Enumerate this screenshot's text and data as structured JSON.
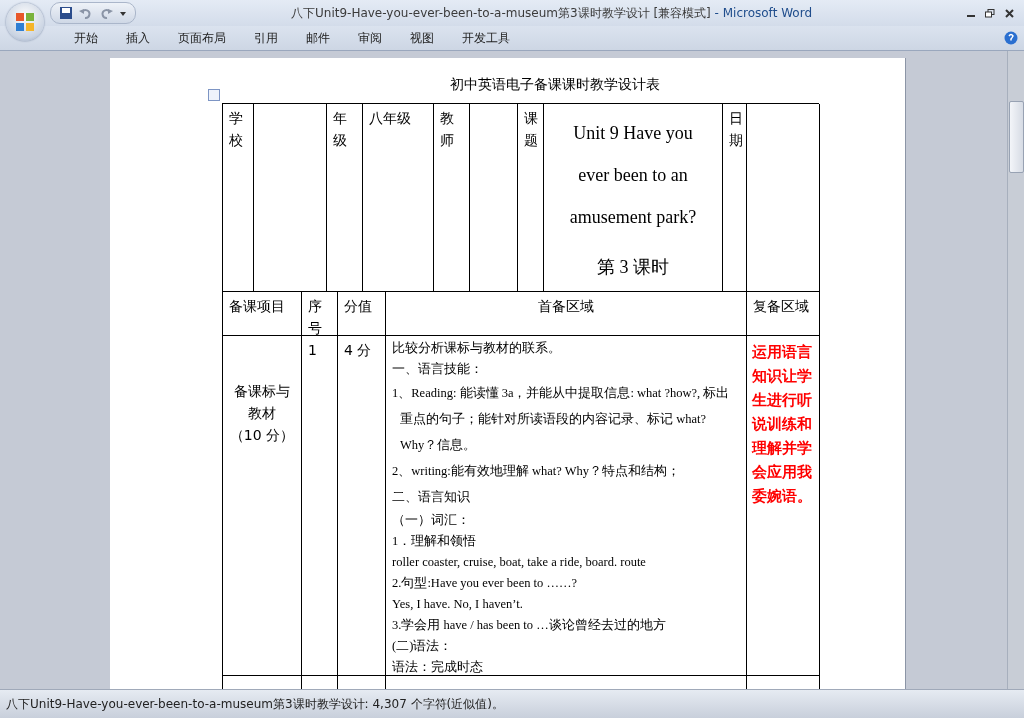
{
  "window": {
    "title": "八下Unit9-Have-you-ever-been-to-a-museum第3课时教学设计 [兼容模式]",
    "app": " - Microsoft Word"
  },
  "ribbon_tabs": [
    "开始",
    "插入",
    "页面布局",
    "引用",
    "邮件",
    "审阅",
    "视图",
    "开发工具"
  ],
  "document": {
    "heading": "初中英语电子备课课时教学设计表",
    "info_row": [
      {
        "kind": "label",
        "text": "学校"
      },
      {
        "kind": "blank"
      },
      {
        "kind": "label",
        "text": "年级"
      },
      {
        "kind": "value",
        "text": "八年级"
      },
      {
        "kind": "label",
        "text": "教师"
      },
      {
        "kind": "blank"
      },
      {
        "kind": "label",
        "text": "课题"
      },
      {
        "kind": "title",
        "lines": [
          "Unit 9 Have you ever been to an amusement park?",
          "第 3 课时"
        ]
      },
      {
        "kind": "label",
        "text": "日期"
      },
      {
        "kind": "blank"
      }
    ],
    "header_row": [
      "备课项目",
      "序号",
      "分值",
      "首备区域",
      "复备区域"
    ],
    "rows": [
      {
        "item_lines": [
          "备课标与",
          "教材",
          "（10 分）"
        ],
        "number": "1",
        "score": "4 分",
        "content": [
          {
            "kind": "line",
            "text": "比较分析课标与教材的联系。"
          },
          {
            "kind": "line",
            "text": "一、语言技能："
          },
          {
            "kind": "para",
            "text": "1、Reading: 能读懂 3a，并能从中提取信息: what ?how?, 标出重点的句子；能针对所读语段的内容记录、标记 what? Why？信息。"
          },
          {
            "kind": "para",
            "text": "2、writing:能有效地理解 what? Why？特点和结构；"
          },
          {
            "kind": "para",
            "text": "二、语言知识"
          },
          {
            "kind": "line",
            "text": "（一）词汇："
          },
          {
            "kind": "line",
            "text": "1．理解和领悟"
          },
          {
            "kind": "line",
            "text": "roller coaster, cruise, boat, take a ride, board. route"
          },
          {
            "kind": "line",
            "text": "2.句型:Have you ever been to ……?"
          },
          {
            "kind": "line",
            "text": "Yes, I have.  No, I haven’t."
          },
          {
            "kind": "line",
            "text": "3.学会用 have / has been to …谈论曾经去过的地方"
          },
          {
            "kind": "line",
            "text": "(二)语法："
          },
          {
            "kind": "line",
            "text": "语法：完成时态"
          }
        ],
        "review": "运用语言知识让学生进行听说训练和理解并学会应用我委婉语。"
      }
    ]
  },
  "status_bar": "八下Unit9-Have-you-ever-been-to-a-museum第3课时教学设计: 4,307 个字符(近似值)。"
}
